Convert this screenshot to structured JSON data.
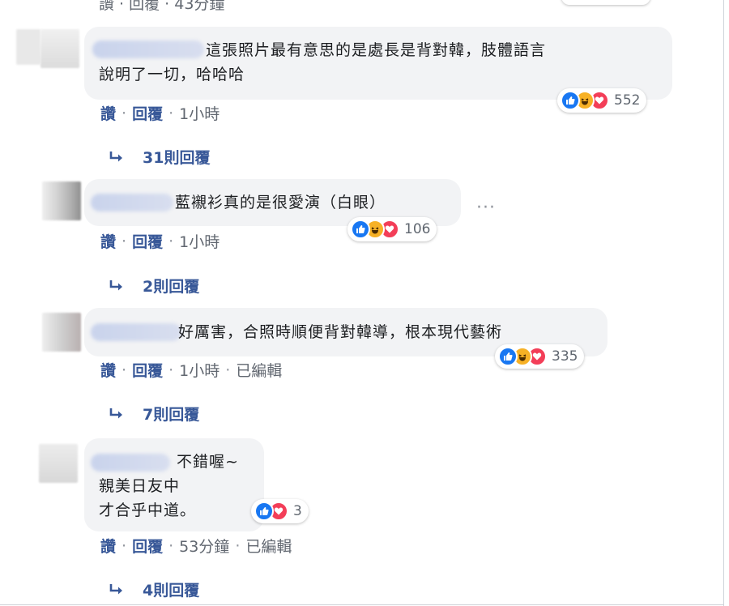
{
  "top_meta": {
    "text": "讚 · 回覆 · 43分鐘"
  },
  "comments": [
    {
      "text": "這張照片最有意思的是處長是背對韓，肢體語言\n說明了一切，哈哈哈",
      "count": "552",
      "like": "讚",
      "reply": "回覆",
      "time": "1小時",
      "replies": "31則回覆"
    },
    {
      "text": "藍襯衫真的是很愛演（白眼）",
      "count": "106",
      "like": "讚",
      "reply": "回覆",
      "time": "1小時",
      "replies": "2則回覆"
    },
    {
      "text": "好厲害，合照時順便背對韓導，根本現代藝術",
      "count": "335",
      "like": "讚",
      "reply": "回覆",
      "time": "1小時",
      "edited": "已編輯",
      "replies": "7則回覆"
    },
    {
      "text": "不錯喔~\n親美日友中\n才合乎中道。",
      "count": "3",
      "like": "讚",
      "reply": "回覆",
      "time": "53分鐘",
      "edited": "已編輯",
      "replies": "4則回覆"
    }
  ],
  "icons": [
    "like-icon",
    "haha-icon",
    "love-icon",
    "reply-arrow-icon",
    "more-options-icon"
  ],
  "colors": {
    "link": "#385898",
    "bubble": "#f2f3f5",
    "like": "#1877f2",
    "haha": "#f7b125",
    "love": "#f33e58"
  }
}
